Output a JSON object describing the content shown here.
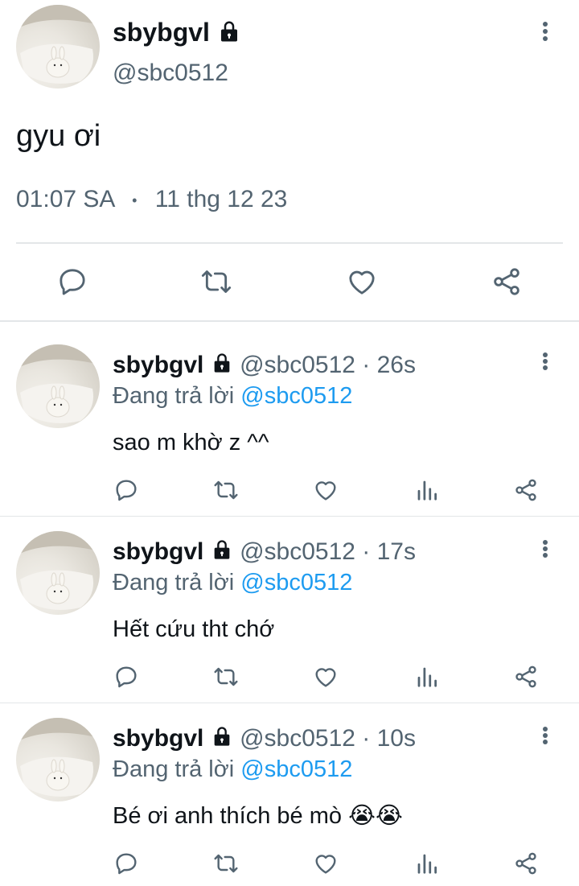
{
  "main_tweet": {
    "display_name": "sbybgvl",
    "handle": "@sbc0512",
    "text": "gyu ơi",
    "time": "01:07 SA",
    "separator": "•",
    "date": "11 thg 12 23",
    "icons": [
      "comment-icon",
      "retweet-icon",
      "heart-icon",
      "share-icon"
    ]
  },
  "replies": [
    {
      "display_name": "sbybgvl",
      "handle_time": "@sbc0512 · 26s",
      "replying_prefix": "Đang trả lời",
      "replying_to": "@sbc0512",
      "text": "sao m khờ z ^^",
      "emoji": ""
    },
    {
      "display_name": "sbybgvl",
      "handle_time": "@sbc0512 · 17s",
      "replying_prefix": "Đang trả lời",
      "replying_to": "@sbc0512",
      "text": "Hết cứu tht chớ",
      "emoji": ""
    },
    {
      "display_name": "sbybgvl",
      "handle_time": "@sbc0512 · 10s",
      "replying_prefix": "Đang trả lời",
      "replying_to": "@sbc0512",
      "text": "Bé ơi anh thích bé mò",
      "emoji": "😭😭"
    }
  ],
  "colors": {
    "text": "#0f1419",
    "muted": "#536471",
    "link": "#1d9bf0",
    "divider": "#e3e6e8"
  }
}
